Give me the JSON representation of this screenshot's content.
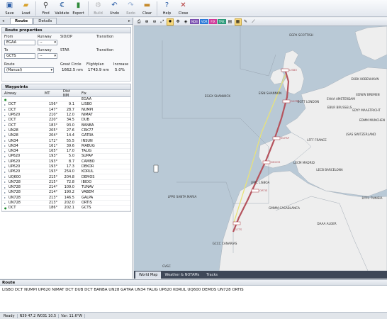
{
  "toolbar": {
    "buttons": [
      {
        "label": "Save",
        "icon": "save-icon",
        "enabled": true
      },
      {
        "label": "Load",
        "icon": "folder-icon",
        "enabled": true
      },
      {
        "label": "Find",
        "icon": "search-icon",
        "enabled": true
      },
      {
        "label": "Validate",
        "icon": "validate-icon",
        "enabled": true
      },
      {
        "label": "Export",
        "icon": "export-icon",
        "enabled": true
      },
      {
        "label": "Build",
        "icon": "build-icon",
        "enabled": false
      },
      {
        "label": "Undo",
        "icon": "undo-icon",
        "enabled": true
      },
      {
        "label": "Redo",
        "icon": "redo-icon",
        "enabled": false
      },
      {
        "label": "Clear",
        "icon": "clear-icon",
        "enabled": true
      },
      {
        "label": "Help",
        "icon": "help-icon",
        "enabled": true
      },
      {
        "label": "Close",
        "icon": "close-icon",
        "enabled": true
      }
    ]
  },
  "left_tabs": [
    "Route",
    "Details"
  ],
  "route_properties": {
    "title": "Route properties",
    "from_label": "From",
    "from_value": "EGAA",
    "from_runway_label": "Runway",
    "from_runway_value": "--",
    "sid_label": "SID/DP",
    "from_transition_label": "Transition",
    "to_label": "To",
    "to_value": "GCTS",
    "to_runway_label": "Runway",
    "to_runway_value": "--",
    "star_label": "STAR",
    "to_transition_label": "Transition",
    "route_label": "Route",
    "route_value": "(Manual)",
    "gc_label": "Great Circle",
    "gc_value": "1662.5 nm",
    "fp_label": "Flightplan",
    "fp_value": "1743.9 nm",
    "inc_label": "Increase",
    "inc_value": "5.0%"
  },
  "waypoints": {
    "title": "Waypoints",
    "headers": {
      "airway": "Airway",
      "mt": "MT",
      "dist": "Dist NM",
      "fix": "Fix"
    },
    "rows": [
      {
        "airway": "",
        "mt": "",
        "dist": "",
        "fix": "EGAA",
        "marker": "start"
      },
      {
        "airway": "DCT",
        "mt": "156°",
        "dist": "9.1",
        "fix": "LISBO"
      },
      {
        "airway": "DCT",
        "mt": "147°",
        "dist": "28.7",
        "fix": "NUMPI"
      },
      {
        "airway": "UP620",
        "mt": "210°",
        "dist": "12.0",
        "fix": "NIMAT"
      },
      {
        "airway": "DCT",
        "mt": "220°",
        "dist": "34.5",
        "fix": "DUB"
      },
      {
        "airway": "DCT",
        "mt": "183°",
        "dist": "93.0",
        "fix": "BANBA"
      },
      {
        "airway": "UN28",
        "mt": "205°",
        "dist": "27.6",
        "fix": "CRK77"
      },
      {
        "airway": "UN28",
        "mt": "204°",
        "dist": "14.4",
        "fix": "GATRA"
      },
      {
        "airway": "UN34",
        "mt": "172°",
        "dist": "55.5",
        "fix": "INSUN"
      },
      {
        "airway": "UN34",
        "mt": "161°",
        "dist": "39.6",
        "fix": "MABUG"
      },
      {
        "airway": "UN34",
        "mt": "165°",
        "dist": "17.0",
        "fix": "TALIG"
      },
      {
        "airway": "UP620",
        "mt": "193°",
        "dist": "5.0",
        "fix": "SUPAP"
      },
      {
        "airway": "UP620",
        "mt": "193°",
        "dist": "8.7",
        "fix": "CAMBO"
      },
      {
        "airway": "UP620",
        "mt": "193°",
        "dist": "17.3",
        "fix": "DEKOR"
      },
      {
        "airway": "UP620",
        "mt": "193°",
        "dist": "254.0",
        "fix": "KORUL"
      },
      {
        "airway": "UQ600",
        "mt": "215°",
        "dist": "204.8",
        "fix": "DEMOS"
      },
      {
        "airway": "UN728",
        "mt": "215°",
        "dist": "72.8",
        "fix": "IBIDO"
      },
      {
        "airway": "UN728",
        "mt": "214°",
        "dist": "109.0",
        "fix": "TUNAV"
      },
      {
        "airway": "UN728",
        "mt": "214°",
        "dist": "190.2",
        "fix": "VABEM"
      },
      {
        "airway": "UN728",
        "mt": "213°",
        "dist": "146.5",
        "fix": "GALPA"
      },
      {
        "airway": "UN728",
        "mt": "213°",
        "dist": "202.0",
        "fix": "ORTIS"
      },
      {
        "airway": "DCT",
        "mt": "186°",
        "dist": "202.1",
        "fix": "GCTS",
        "marker": "end"
      }
    ]
  },
  "map": {
    "tabs": [
      "World Map",
      "Weather & NOTAMs",
      "Tracks"
    ],
    "active_tab": "World Map",
    "filter_tags": [
      {
        "label": "NDB",
        "color": "#7a4fb0"
      },
      {
        "label": "VOR",
        "color": "#2d7ad8"
      },
      {
        "label": "FIX",
        "color": "#d03a9a"
      },
      {
        "label": "TRK",
        "color": "#2c9a7a"
      }
    ],
    "labels": [
      {
        "text": "EGPX SCOTTISH"
      },
      {
        "text": "EISN SHANNON"
      },
      {
        "text": "EGGX SHANWICK"
      },
      {
        "text": "EGTT LONDON"
      },
      {
        "text": "EBUR BRUSSELS"
      },
      {
        "text": "EHAA AMSTERDAM"
      },
      {
        "text": "EKDK KOBENHAVN"
      },
      {
        "text": "EDWW BREMEN"
      },
      {
        "text": "EDYY MAASTRICHT"
      },
      {
        "text": "EDMM MUNCHEN"
      },
      {
        "text": "LSAS SWITZERLAND"
      },
      {
        "text": "LFFF FRANCE"
      },
      {
        "text": "LECM MADRID"
      },
      {
        "text": "LECB BARCELONA"
      },
      {
        "text": "LPPC LISBOA"
      },
      {
        "text": "LPPO SANTA MARIA"
      },
      {
        "text": "GMMM CASABLANCA"
      },
      {
        "text": "DTTC TUNISIA"
      },
      {
        "text": "DAAA ALGER"
      },
      {
        "text": "GCCC CANARIAS"
      },
      {
        "text": "GVSC"
      }
    ],
    "route_fixes": [
      "LISBO",
      "GATRA",
      "SUPAP",
      "DEKOR",
      "ORTIS",
      "GCTS"
    ]
  },
  "route_panel": {
    "title": "Route",
    "text": "LISBO DCT NUMPI UP620 NIMAT DCT DUB DCT BANBA UN28 GATRA UN34 TALIG UP620 KORUL UQ600 DEMOS UN728 ORTIS"
  },
  "status_bar": {
    "state": "Ready",
    "position": "N39 47.2 W031 10.5",
    "variation": "Var: 11.6°W"
  },
  "colors": {
    "route_line": "#b5545e",
    "great_circle": "#e8e27a",
    "sea": "#b9c9d6",
    "land": "#eeeeee"
  }
}
